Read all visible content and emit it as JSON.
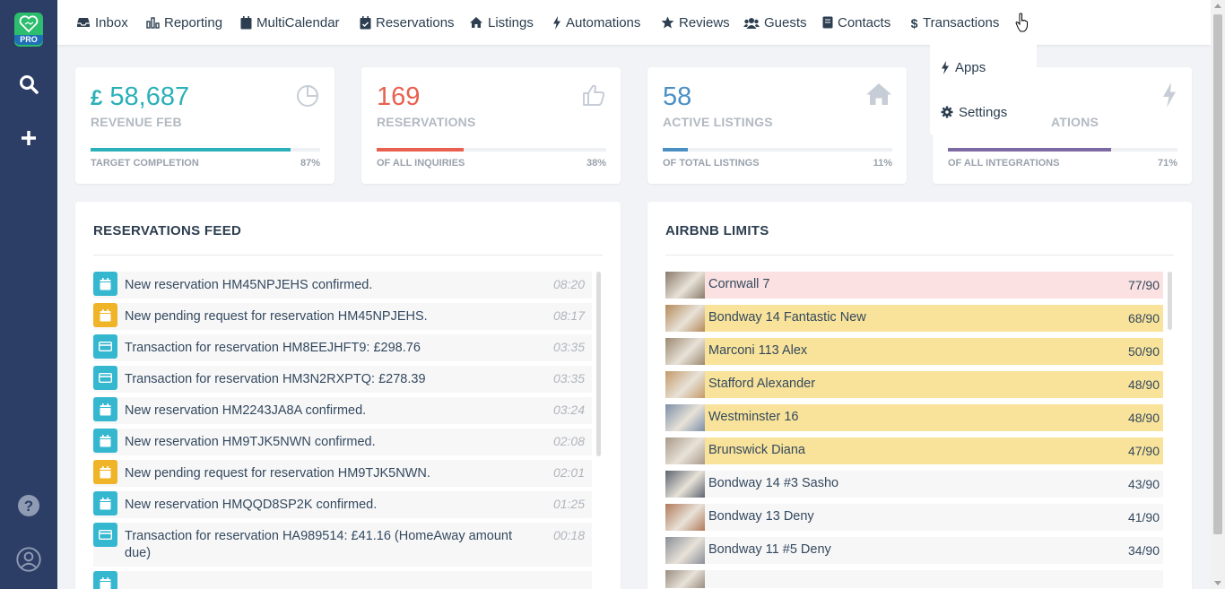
{
  "sidebar": {
    "logo_badge": "PRO",
    "brand_color": "#2dbd6e",
    "bg_color": "#2c3e66",
    "icons": [
      "search-icon",
      "plus-icon",
      "help-icon",
      "user-icon"
    ]
  },
  "nav": {
    "items": [
      {
        "label": "Inbox",
        "icon": "inbox-icon"
      },
      {
        "label": "Reporting",
        "icon": "bar-chart-icon"
      },
      {
        "label": "MultiCalendar",
        "icon": "calendar-icon"
      },
      {
        "label": "Reservations",
        "icon": "calendar-check-icon"
      },
      {
        "label": "Listings",
        "icon": "home-icon"
      },
      {
        "label": "Automations",
        "icon": "bolt-icon"
      },
      {
        "label": "Reviews",
        "icon": "star-icon"
      },
      {
        "label": "Guests",
        "icon": "users-icon"
      },
      {
        "label": "Contacts",
        "icon": "address-book-icon"
      },
      {
        "label": "Transactions",
        "icon": "dollar-icon"
      }
    ],
    "dropdown": [
      {
        "label": "Apps",
        "icon": "bolt-icon"
      },
      {
        "label": "Settings",
        "icon": "gear-icon"
      }
    ]
  },
  "stats": [
    {
      "value": "£ 58,687",
      "label": "REVENUE FEB",
      "footer": "TARGET COMPLETION",
      "percent": "87%",
      "progress": 0.87,
      "color": "#2ab0b8",
      "value_color": "#2ab0b8",
      "icon": "pie-chart-icon"
    },
    {
      "value": "169",
      "label": "RESERVATIONS",
      "footer": "OF ALL INQUIRIES",
      "percent": "38%",
      "progress": 0.38,
      "color": "#e9604f",
      "value_color": "#e9604f",
      "icon": "thumbs-up-icon"
    },
    {
      "value": "58",
      "label": "ACTIVE LISTINGS",
      "footer": "OF TOTAL LISTINGS",
      "percent": "11%",
      "progress": 0.11,
      "color": "#4a8fc4",
      "value_color": "#4a8fc4",
      "icon": "home-icon"
    },
    {
      "value": "",
      "label": "ATIONS",
      "footer": "OF ALL INTEGRATIONS",
      "percent": "71%",
      "progress": 0.71,
      "color": "#7d6aa4",
      "value_color": "#7d6aa4",
      "icon": "bolt-icon"
    }
  ],
  "feed": {
    "title": "RESERVATIONS FEED",
    "items": [
      {
        "text": "New reservation HM45NPJEHS confirmed.",
        "time": "08:20",
        "type": "calendar",
        "color": "#35b8cf"
      },
      {
        "text": "New pending request for reservation HM45NPJEHS.",
        "time": "08:17",
        "type": "calendar",
        "color": "#f0b429"
      },
      {
        "text": "Transaction for reservation HM8EEJHFT9: £298.76",
        "time": "03:35",
        "type": "card",
        "color": "#35b8cf"
      },
      {
        "text": "Transaction for reservation HM3N2RXPTQ: £278.39",
        "time": "03:35",
        "type": "card",
        "color": "#35b8cf"
      },
      {
        "text": "New reservation HM2243JA8A confirmed.",
        "time": "03:24",
        "type": "calendar",
        "color": "#35b8cf"
      },
      {
        "text": "New reservation HM9TJK5NWN confirmed.",
        "time": "02:08",
        "type": "calendar",
        "color": "#35b8cf"
      },
      {
        "text": "New pending request for reservation HM9TJK5NWN.",
        "time": "02:01",
        "type": "calendar",
        "color": "#f0b429"
      },
      {
        "text": "New reservation HMQQD8SP2K confirmed.",
        "time": "01:25",
        "type": "calendar",
        "color": "#35b8cf"
      },
      {
        "text": "Transaction for reservation HA989514: £41.16 (HomeAway amount due)",
        "time": "00:18",
        "type": "card",
        "color": "#35b8cf"
      },
      {
        "text": "",
        "time": "",
        "type": "calendar",
        "color": "#35b8cf"
      }
    ]
  },
  "limits": {
    "title": "AIRBNB LIMITS",
    "items": [
      {
        "name": "Cornwall 7",
        "count": "77/90",
        "bg": "#fbe1e1",
        "thumb": "#8a7a6a"
      },
      {
        "name": "Bondway 14 Fantastic New",
        "count": "68/90",
        "bg": "#f9e39a",
        "thumb": "#b48a5a"
      },
      {
        "name": "Marconi 113 Alex",
        "count": "50/90",
        "bg": "#f9e39a",
        "thumb": "#9c8870"
      },
      {
        "name": "Stafford Alexander",
        "count": "48/90",
        "bg": "#f9e39a",
        "thumb": "#c49a68"
      },
      {
        "name": "Westminster 16",
        "count": "48/90",
        "bg": "#f9e39a",
        "thumb": "#7c8fa8"
      },
      {
        "name": "Brunswick Diana",
        "count": "47/90",
        "bg": "#f9e39a",
        "thumb": "#a89a8a"
      },
      {
        "name": "Bondway 14 #3 Sasho",
        "count": "43/90",
        "bg": "#f7f7f8",
        "thumb": "#5c6470"
      },
      {
        "name": "Bondway 13 Deny",
        "count": "41/90",
        "bg": "#f7f7f8",
        "thumb": "#b07a5a"
      },
      {
        "name": "Bondway 11 #5 Deny",
        "count": "34/90",
        "bg": "#f7f7f8",
        "thumb": "#8a8f98"
      },
      {
        "name": "",
        "count": "",
        "bg": "#f7f7f8",
        "thumb": "#9a8c80"
      }
    ]
  }
}
